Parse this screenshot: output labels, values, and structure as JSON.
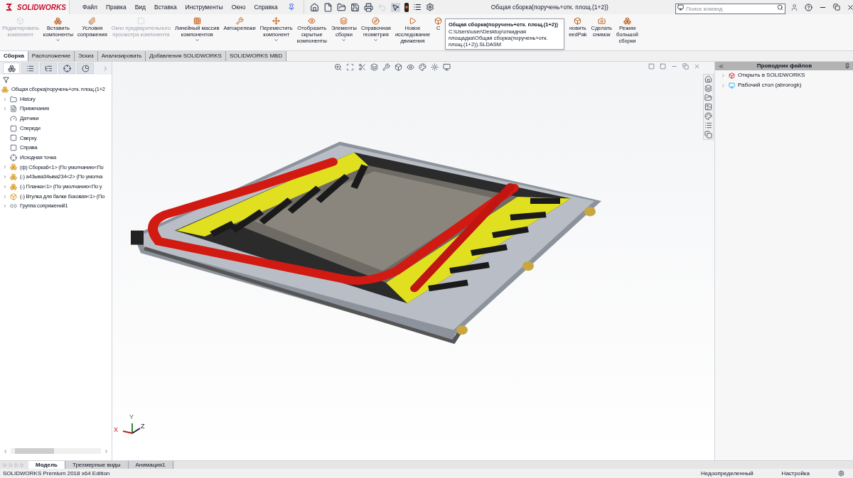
{
  "app": {
    "logo": "SOLIDWORKS",
    "menu": [
      "Файл",
      "Правка",
      "Вид",
      "Вставка",
      "Инструменты",
      "Окно",
      "Справка"
    ],
    "title": "Общая сборка(поручень+отк. площ.(1+2))",
    "search": {
      "placeholder": "Поиск команд"
    }
  },
  "ribbon": [
    {
      "label": "Редактировать\nкомпонент",
      "disabled": true,
      "dropdown": false
    },
    {
      "label": "Вставить\nкомпоненты",
      "disabled": false,
      "dropdown": true
    },
    {
      "label": "Условия\nсопряжения",
      "disabled": false,
      "dropdown": false
    },
    {
      "label": "Окно предварительного\nпросмотра компонента",
      "disabled": true,
      "dropdown": false
    },
    {
      "label": "Линейный массив\nкомпонентов",
      "disabled": false,
      "dropdown": true
    },
    {
      "label": "Автокрепежи",
      "disabled": false,
      "dropdown": false
    },
    {
      "label": "Переместить\nкомпонент",
      "disabled": false,
      "dropdown": true
    },
    {
      "label": "Отобразить\nскрытые\nкомпоненты",
      "disabled": false,
      "dropdown": false
    },
    {
      "label": "Элементы\nсборки",
      "disabled": false,
      "dropdown": true
    },
    {
      "label": "Справочная\nгеометрия",
      "disabled": false,
      "dropdown": true
    },
    {
      "label": "Новое\nисследование\nдвижения",
      "disabled": false,
      "dropdown": false
    },
    {
      "label": "С",
      "disabled": false,
      "dropdown": false
    },
    {
      "label": "новить\needPak",
      "disabled": false,
      "dropdown": false
    },
    {
      "label": "Сделать\nснимок",
      "disabled": false,
      "dropdown": false
    },
    {
      "label": "Режим\nбольшой\nсборки",
      "disabled": false,
      "dropdown": false
    }
  ],
  "tooltip": {
    "title": "Общая сборка(поручень+отк. площ.(1+2))",
    "path": "C:\\Users\\user\\Desktop\\откидная площадка\\Общая сборка(поручень+отк. площ.(1+2)).SLDASM"
  },
  "command_tabs": [
    {
      "label": "Сборка",
      "selected": true
    },
    {
      "label": "Расположение",
      "selected": false
    },
    {
      "label": "Эскиз",
      "selected": false
    },
    {
      "label": "Анализировать",
      "selected": false
    },
    {
      "label": "Добавления SOLIDWORKS",
      "selected": false
    },
    {
      "label": "SOLIDWORKS MBD",
      "selected": false
    }
  ],
  "panel_tabs": [
    {
      "selected": true
    },
    {
      "selected": false
    },
    {
      "selected": false
    },
    {
      "selected": false
    },
    {
      "selected": false
    }
  ],
  "feature_tree": {
    "root": "Общая сборка(поручень+отк. площ.(1+2",
    "items": [
      {
        "kind": "folder",
        "label": "History",
        "expandable": true
      },
      {
        "kind": "notes",
        "label": "Примечания",
        "expandable": true
      },
      {
        "kind": "sensor",
        "label": "Датчики",
        "expandable": false
      },
      {
        "kind": "plane",
        "label": "Спереди",
        "expandable": false
      },
      {
        "kind": "plane",
        "label": "Сверху",
        "expandable": false
      },
      {
        "kind": "plane",
        "label": "Справа",
        "expandable": false
      },
      {
        "kind": "origin",
        "label": "Исходная точка",
        "expandable": false
      },
      {
        "kind": "assembly",
        "label": "(ф) Сборка6<1> (По умолчанию<По",
        "expandable": true
      },
      {
        "kind": "assembly",
        "label": "(-) а43ыва34ыва234<2> (По умолча",
        "expandable": true
      },
      {
        "kind": "assembly",
        "label": "(-) Планка<1> (По умолчанию<По у",
        "expandable": true
      },
      {
        "kind": "part",
        "label": "(-) Втулка для балки боковая<1> (По",
        "expandable": true
      },
      {
        "kind": "mates",
        "label": "Группа сопряжений1",
        "expandable": true
      }
    ]
  },
  "task_pane": {
    "title": "Проводник файлов",
    "items": [
      {
        "kind": "open",
        "label": "Открыть в SOLIDWORKS"
      },
      {
        "kind": "desktop",
        "label": "Рабочий стол (abrorogk)"
      }
    ]
  },
  "bottom_tabs": [
    {
      "label": "Модель",
      "selected": true
    },
    {
      "label": "Трехмерные виды",
      "selected": false
    },
    {
      "label": "Анимация1",
      "selected": false
    }
  ],
  "status_bar": {
    "edition": "SOLIDWORKS Premium 2018 x64 Edition",
    "state": "Недоопределенный",
    "units": "Настройка"
  },
  "triad": [
    "X",
    "Y",
    "Z"
  ]
}
